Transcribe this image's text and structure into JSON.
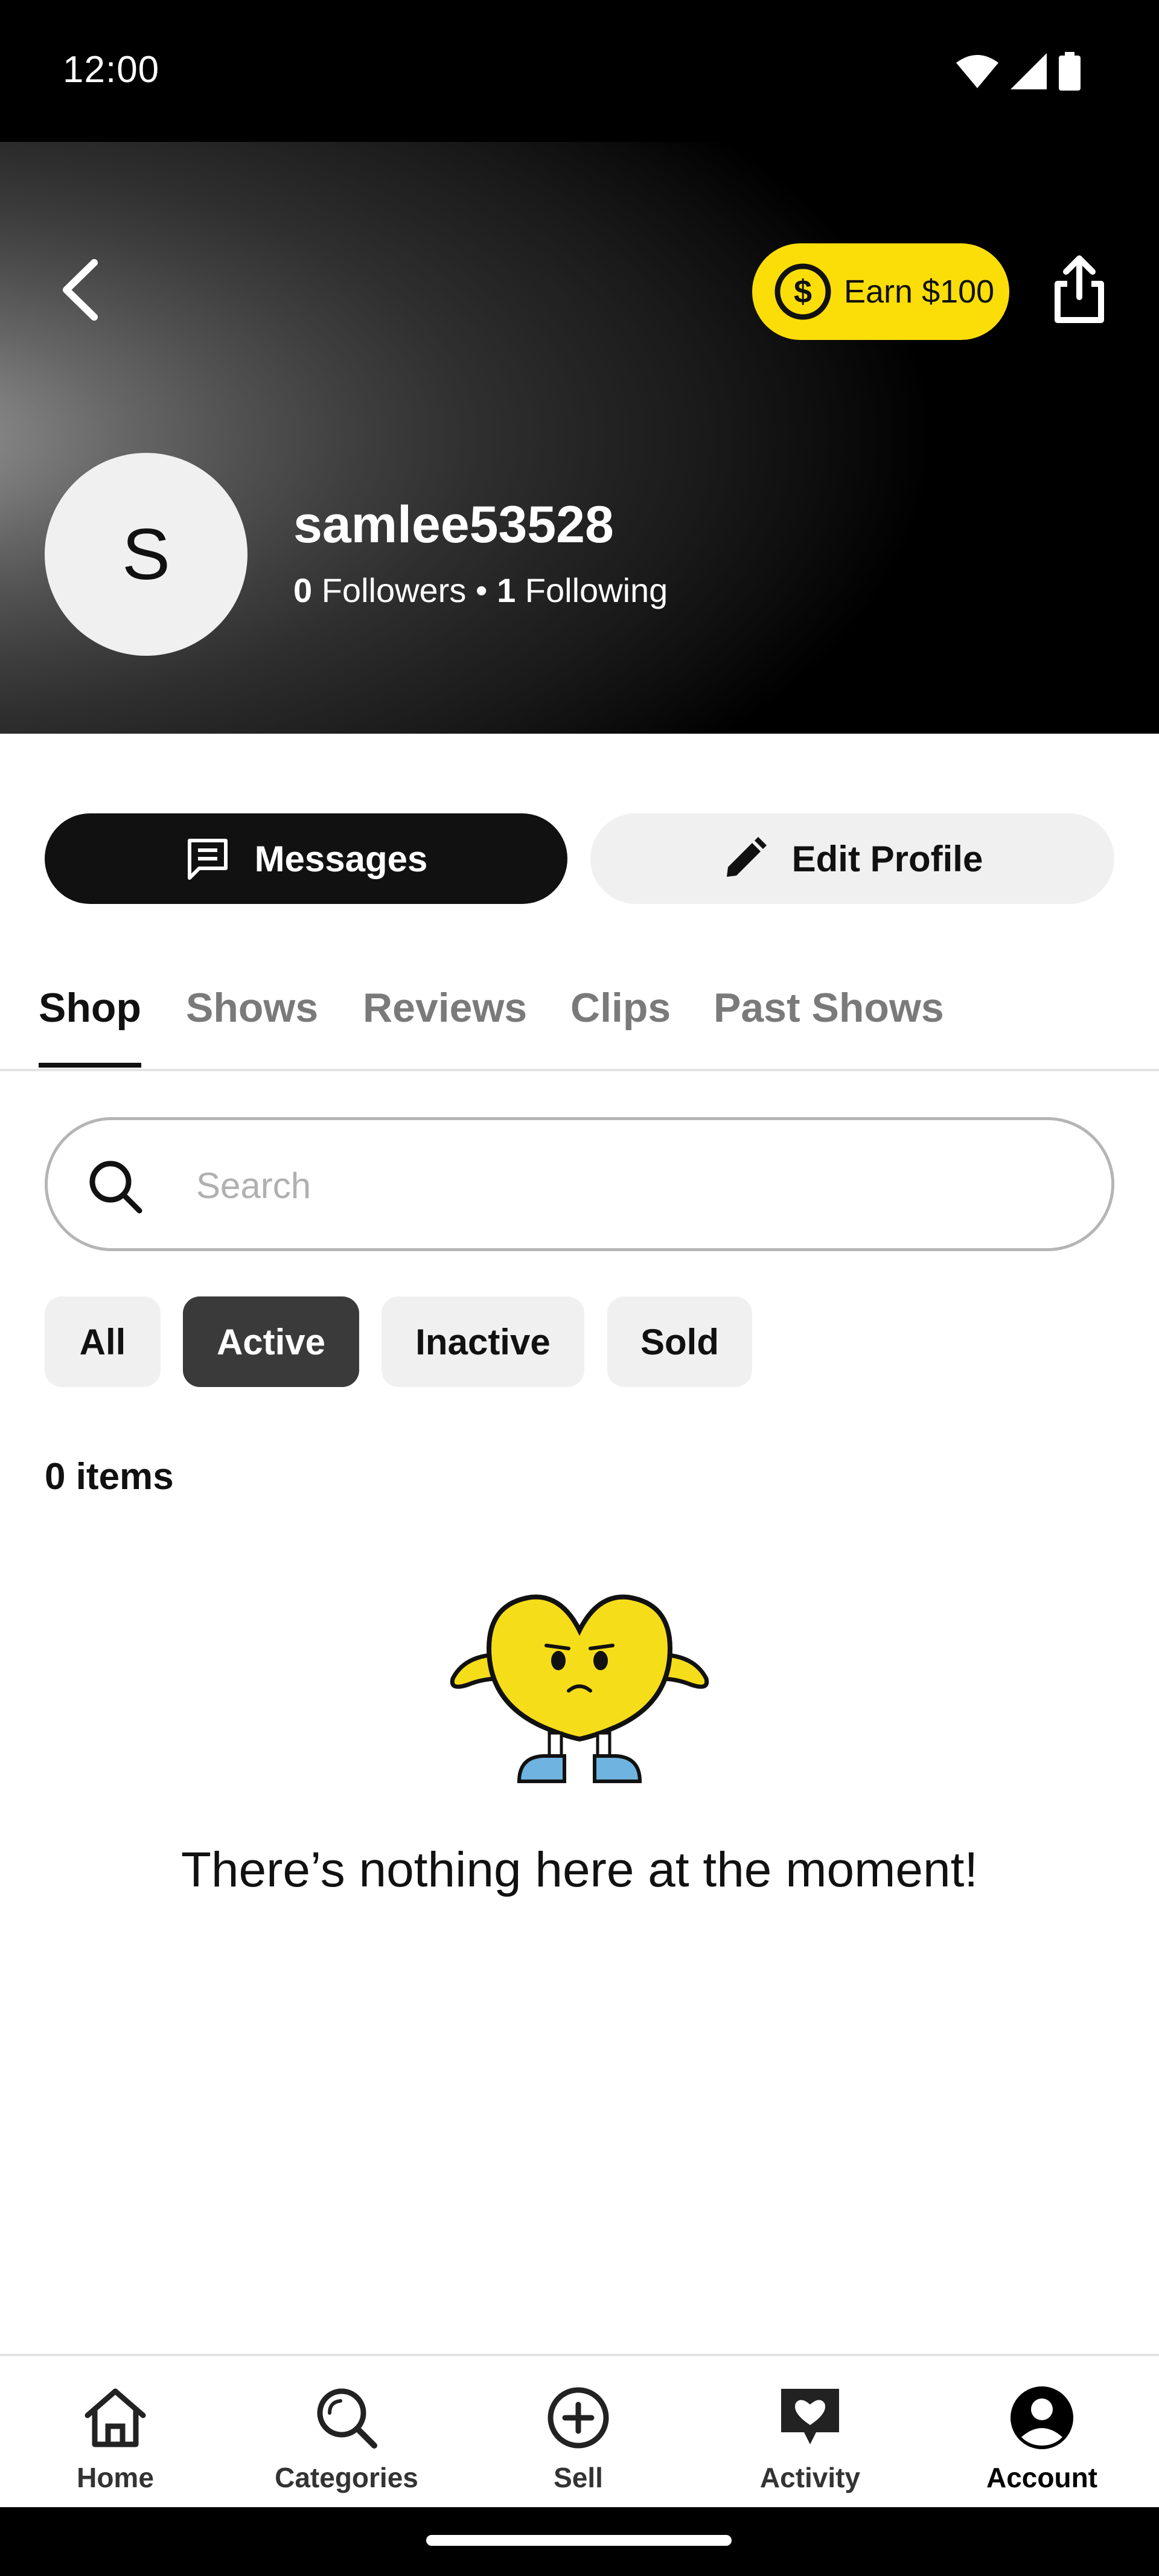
{
  "status_bar": {
    "time": "12:00",
    "icons": [
      "wifi-icon",
      "signal-icon",
      "battery-icon"
    ]
  },
  "header": {
    "earn_label": "Earn $100",
    "avatar_initial": "S",
    "username": "samlee53528",
    "followers_count": "0",
    "followers_label": " Followers • ",
    "following_count": "1",
    "following_label": " Following"
  },
  "actions": {
    "messages_label": "Messages",
    "edit_profile_label": "Edit Profile"
  },
  "tabs": [
    {
      "label": "Shop",
      "active": true
    },
    {
      "label": "Shows",
      "active": false
    },
    {
      "label": "Reviews",
      "active": false
    },
    {
      "label": "Clips",
      "active": false
    },
    {
      "label": "Past Shows",
      "active": false
    }
  ],
  "search": {
    "placeholder": "Search",
    "value": ""
  },
  "filters": [
    {
      "label": "All",
      "active": false
    },
    {
      "label": "Active",
      "active": true
    },
    {
      "label": "Inactive",
      "active": false
    },
    {
      "label": "Sold",
      "active": false
    }
  ],
  "items_count_label": "0 items",
  "empty_state_text": "There’s nothing here at the moment!",
  "bottom_nav": [
    {
      "label": "Home",
      "icon": "home-icon",
      "active": false
    },
    {
      "label": "Categories",
      "icon": "categories-search-icon",
      "active": false
    },
    {
      "label": "Sell",
      "icon": "plus-circle-icon",
      "active": false
    },
    {
      "label": "Activity",
      "icon": "heart-chat-icon",
      "active": false
    },
    {
      "label": "Account",
      "icon": "account-icon",
      "active": true
    }
  ],
  "colors": {
    "accent_yellow": "#fbde07",
    "dark": "#111111",
    "chip_active": "#3a3a3a",
    "chip_inactive": "#f0f0f0"
  }
}
